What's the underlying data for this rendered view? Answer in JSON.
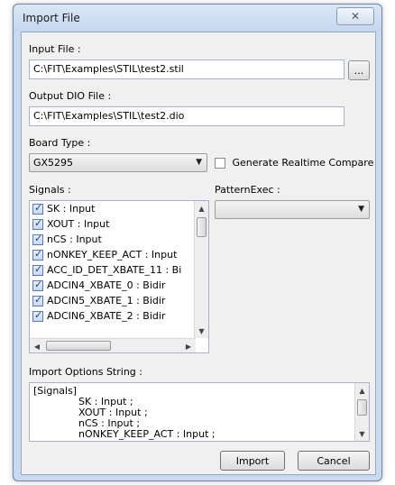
{
  "window": {
    "title": "Import File",
    "close_glyph": "✕"
  },
  "input_file": {
    "label": "Input File :",
    "value": "C:\\FIT\\Examples\\STIL\\test2.stil",
    "browse_label": "..."
  },
  "output_file": {
    "label": "Output DIO File :",
    "value": "C:\\FIT\\Examples\\STIL\\test2.dio"
  },
  "board_type": {
    "label": "Board Type :",
    "selected": "GX5295"
  },
  "realtime": {
    "label": "Generate Realtime Compare",
    "checked": false
  },
  "signals": {
    "label": "Signals :",
    "items": [
      {
        "label": "SK : Input",
        "checked": true
      },
      {
        "label": "XOUT : Input",
        "checked": true
      },
      {
        "label": "nCS : Input",
        "checked": true
      },
      {
        "label": "nONKEY_KEEP_ACT : Input",
        "checked": true
      },
      {
        "label": "ACC_ID_DET_XBATE_11 : Bi",
        "checked": true
      },
      {
        "label": "ADCIN4_XBATE_0 : Bidir",
        "checked": true
      },
      {
        "label": "ADCIN5_XBATE_1 : Bidir",
        "checked": true
      },
      {
        "label": "ADCIN6_XBATE_2 : Bidir",
        "checked": true
      }
    ]
  },
  "pattern_exec": {
    "label": "PatternExec :",
    "selected": ""
  },
  "options": {
    "label": "Import Options String :",
    "lines": [
      "[Signals]",
      "SK : Input ;",
      "XOUT : Input ;",
      "nCS : Input ;",
      "nONKEY_KEEP_ACT : Input ;"
    ]
  },
  "buttons": {
    "import": "Import",
    "cancel": "Cancel"
  }
}
